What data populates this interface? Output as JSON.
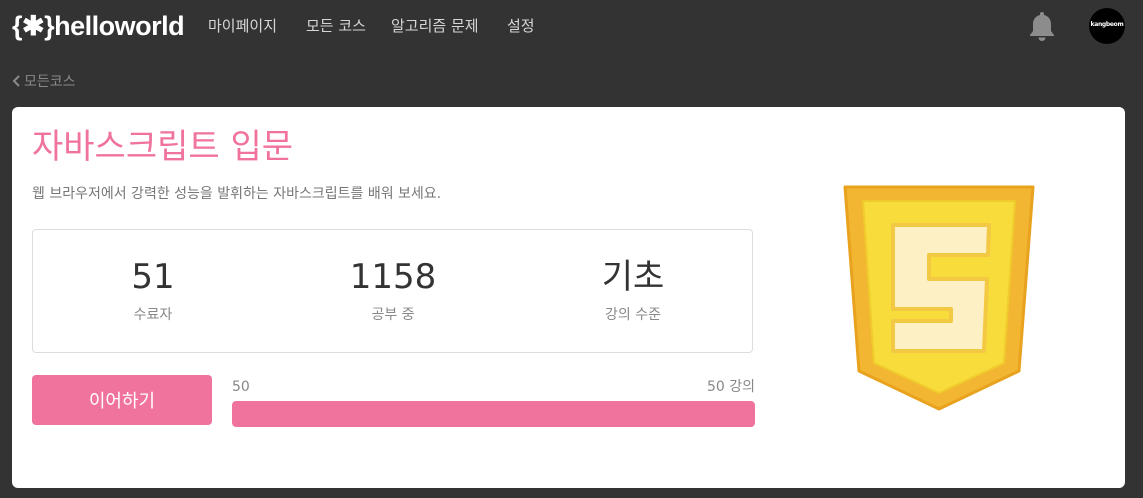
{
  "header": {
    "logo_text": "{✱}helloworld",
    "nav": [
      "마이페이지",
      "모든 코스",
      "알고리즘 문제",
      "설정"
    ],
    "bell_icon": "bell-icon",
    "avatar_text": "kangbeom"
  },
  "breadcrumb": {
    "back_label": "모든코스",
    "icon": "chevron-left-icon"
  },
  "course": {
    "title": "자바스크립트 입문",
    "description": "웹 브라우저에서 강력한 성능을 발휘하는 자바스크립트를 배워 보세요.",
    "stats": [
      {
        "value": "51",
        "label": "수료자"
      },
      {
        "value": "1158",
        "label": "공부 중"
      },
      {
        "value": "기초",
        "label": "강의 수준"
      }
    ],
    "continue_label": "이어하기",
    "progress": {
      "start_label": "50",
      "end_label": "50 강의",
      "fraction": 1.0
    },
    "logo_icon": "js-shield-logo"
  },
  "colors": {
    "accent": "#f0739d",
    "background": "#333333",
    "logo_outer": "#f2b632",
    "logo_inner": "#f7dc3c"
  }
}
